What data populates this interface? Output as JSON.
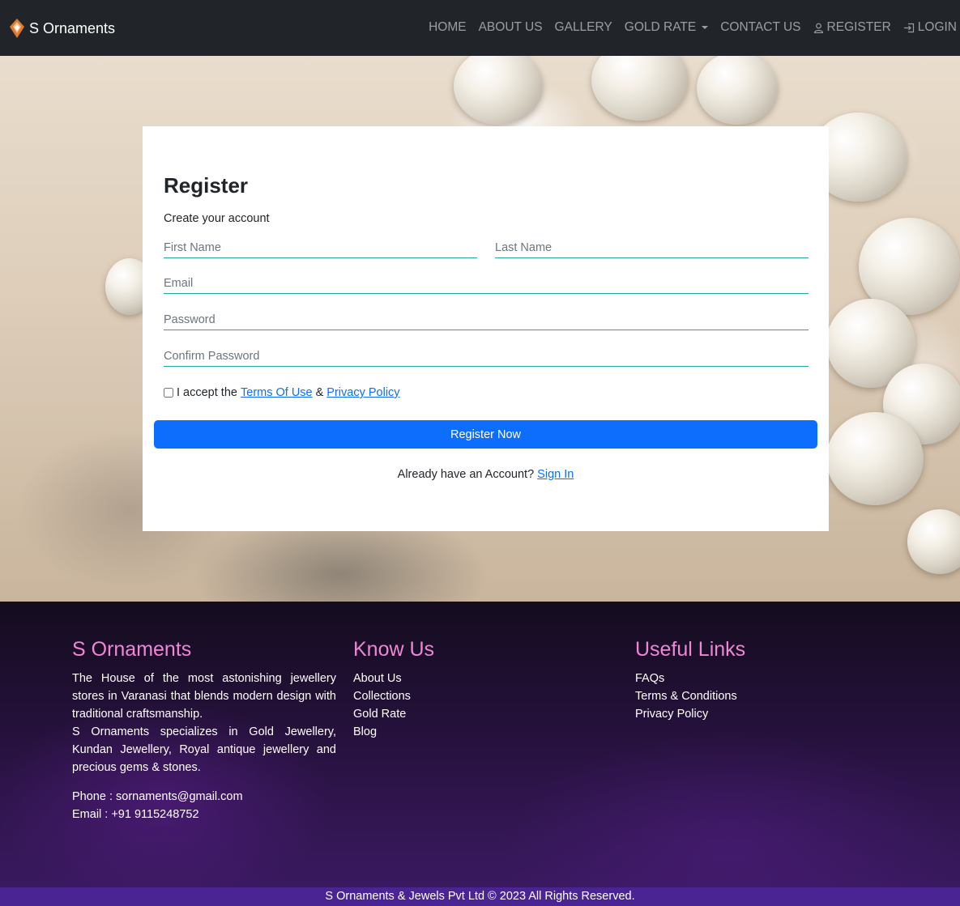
{
  "nav": {
    "brand": "S Ornaments",
    "items": [
      {
        "label": "HOME"
      },
      {
        "label": "ABOUT US"
      },
      {
        "label": "GALLERY"
      },
      {
        "label": "GOLD RATE"
      },
      {
        "label": "CONTACT US"
      },
      {
        "label": "REGISTER",
        "icon": "user-icon"
      },
      {
        "label": "LOGIN",
        "icon": "login-icon"
      }
    ]
  },
  "form": {
    "title": "Register",
    "subtitle": "Create your account",
    "first_name_placeholder": "First Name",
    "last_name_placeholder": "Last Name",
    "email_placeholder": "Email",
    "password_placeholder": "Password",
    "confirm_password_placeholder": "Confirm Password",
    "accept_prefix": "I accept the",
    "terms_link": "Terms Of Use",
    "amp": "&",
    "privacy_link": "Privacy Policy",
    "submit_label": "Register Now",
    "account_prompt": "Already have an Account?",
    "signin_link": "Sign In"
  },
  "footer": {
    "about": {
      "heading": "S Ornaments",
      "text1": "The House of the most astonishing jewellery stores in Varanasi that blends modern design with traditional craftsmanship.",
      "text2": "S Ornaments specializes in Gold Jewellery, Kundan Jewellery, Royal antique jewellery and precious gems & stones.",
      "phone": "Phone : sornaments@gmail.com",
      "email": "Email : +91 9115248752"
    },
    "know_us": {
      "heading": "Know Us",
      "links": [
        "About Us",
        "Collections",
        "Gold Rate",
        "Blog"
      ]
    },
    "useful_links": {
      "heading": "Useful Links",
      "links": [
        "FAQs",
        "Terms & Conditions",
        "Privacy Policy"
      ]
    },
    "copyright": "S Ornaments & Jewels Pvt Ltd © 2023 All Rights Reserved."
  },
  "colors": {
    "navbar_bg": "#212529",
    "primary": "#0d6efd",
    "field_underline": "#20a8a0",
    "footer_heading": "#ef86d6",
    "copyright_bg": "#4b2493"
  }
}
